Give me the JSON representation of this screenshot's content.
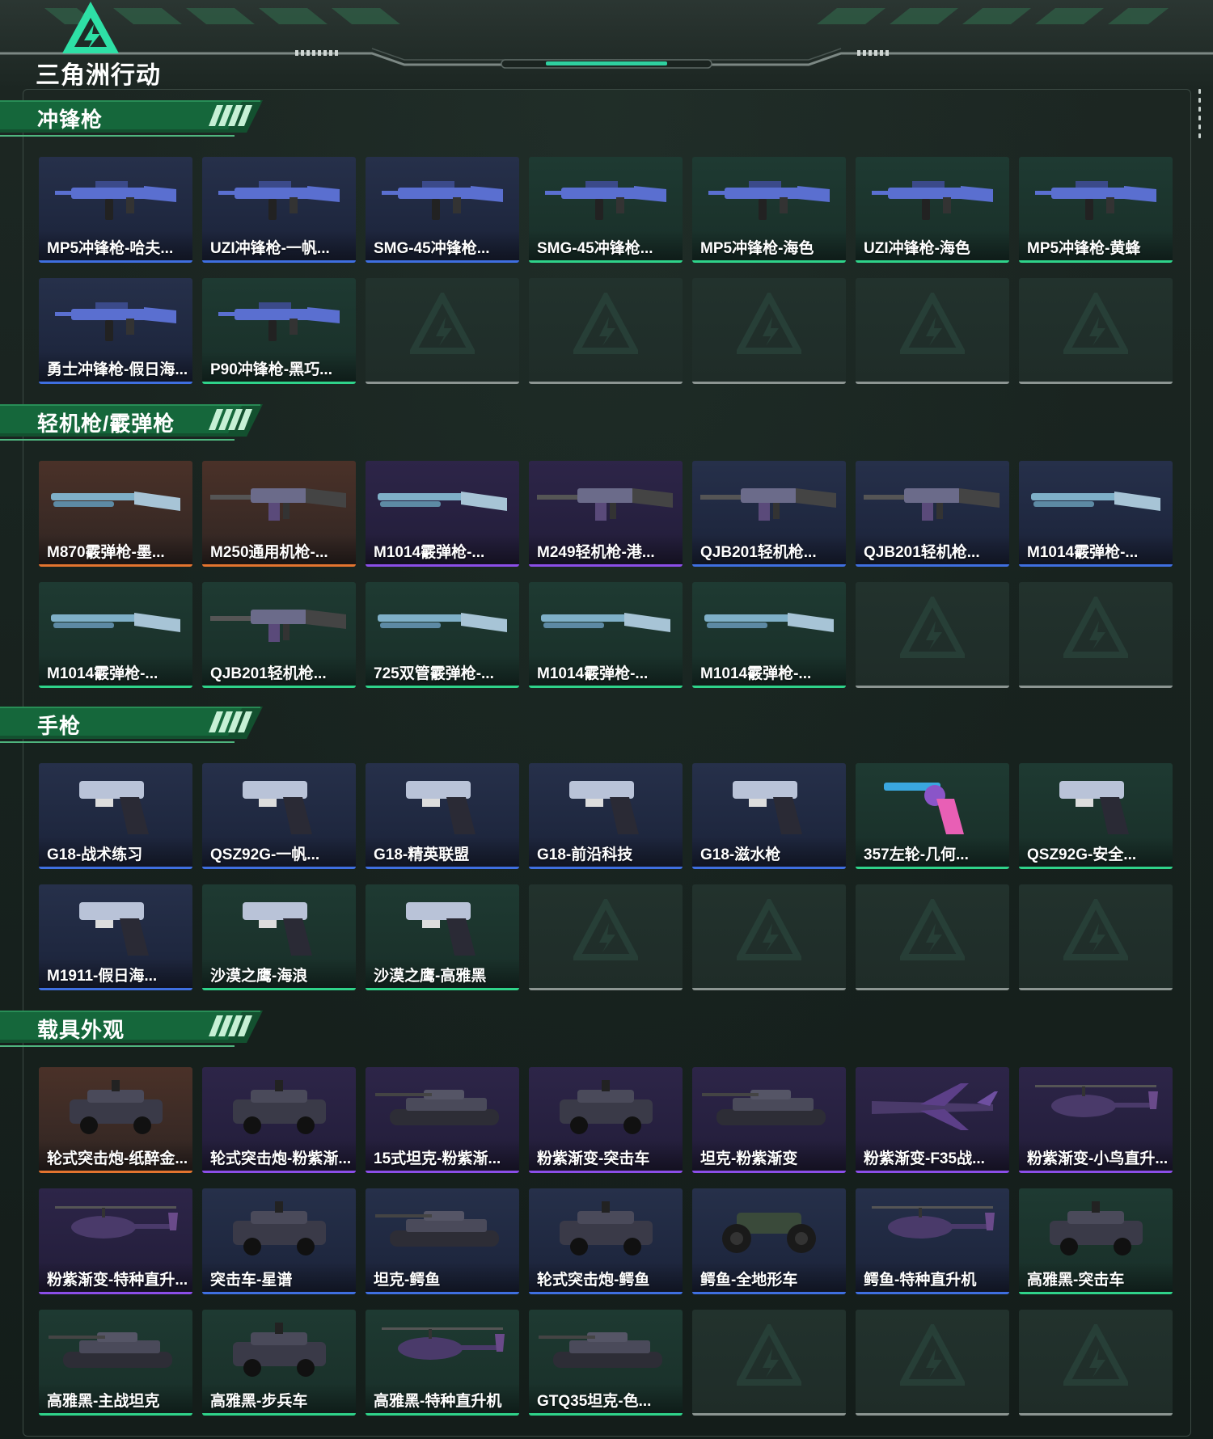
{
  "header": {
    "logo_text": "三角洲行动"
  },
  "colors": {
    "blue": "#3f6fe0",
    "green": "#2fd38a",
    "orange": "#e3742f",
    "purple": "#8b4ee8",
    "empty": "#8c9592",
    "accent": "#28d49a"
  },
  "sections": [
    {
      "title": "冲锋枪",
      "rows": [
        [
          {
            "name": "MP5冲锋枪-哈夫...",
            "rarity": "blue",
            "icon": "smg"
          },
          {
            "name": "UZI冲锋枪-一帆...",
            "rarity": "blue",
            "icon": "smg"
          },
          {
            "name": "SMG-45冲锋枪...",
            "rarity": "blue",
            "icon": "smg"
          },
          {
            "name": "SMG-45冲锋枪...",
            "rarity": "green",
            "icon": "smg"
          },
          {
            "name": "MP5冲锋枪-海色",
            "rarity": "green",
            "icon": "smg"
          },
          {
            "name": "UZI冲锋枪-海色",
            "rarity": "green",
            "icon": "smg"
          },
          {
            "name": "MP5冲锋枪-黄蜂",
            "rarity": "green",
            "icon": "smg"
          }
        ],
        [
          {
            "name": "勇士冲锋枪-假日海...",
            "rarity": "blue",
            "icon": "smg"
          },
          {
            "name": "P90冲锋枪-黑巧...",
            "rarity": "green",
            "icon": "smg"
          },
          null,
          null,
          null,
          null,
          null
        ]
      ]
    },
    {
      "title": "轻机枪/霰弹枪",
      "rows": [
        [
          {
            "name": "M870霰弹枪-墨...",
            "rarity": "orange",
            "icon": "shotgun"
          },
          {
            "name": "M250通用机枪-...",
            "rarity": "orange",
            "icon": "lmg"
          },
          {
            "name": "M1014霰弹枪-...",
            "rarity": "purple",
            "icon": "shotgun"
          },
          {
            "name": "M249轻机枪-港...",
            "rarity": "purple",
            "icon": "lmg"
          },
          {
            "name": "QJB201轻机枪...",
            "rarity": "blue",
            "icon": "lmg"
          },
          {
            "name": "QJB201轻机枪...",
            "rarity": "blue",
            "icon": "lmg"
          },
          {
            "name": "M1014霰弹枪-...",
            "rarity": "blue",
            "icon": "shotgun"
          }
        ],
        [
          {
            "name": "M1014霰弹枪-...",
            "rarity": "green",
            "icon": "shotgun"
          },
          {
            "name": "QJB201轻机枪...",
            "rarity": "green",
            "icon": "lmg"
          },
          {
            "name": "725双管霰弹枪-...",
            "rarity": "green",
            "icon": "shotgun"
          },
          {
            "name": "M1014霰弹枪-...",
            "rarity": "green",
            "icon": "shotgun"
          },
          {
            "name": "M1014霰弹枪-...",
            "rarity": "green",
            "icon": "shotgun"
          },
          null,
          null
        ]
      ]
    },
    {
      "title": "手枪",
      "rows": [
        [
          {
            "name": "G18-战术练习",
            "rarity": "blue",
            "icon": "pistol"
          },
          {
            "name": "QSZ92G-一帆...",
            "rarity": "blue",
            "icon": "pistol"
          },
          {
            "name": "G18-精英联盟",
            "rarity": "blue",
            "icon": "pistol"
          },
          {
            "name": "G18-前沿科技",
            "rarity": "blue",
            "icon": "pistol"
          },
          {
            "name": "G18-滋水枪",
            "rarity": "blue",
            "icon": "pistol"
          },
          {
            "name": "357左轮-几何...",
            "rarity": "green",
            "icon": "revolver"
          },
          {
            "name": "QSZ92G-安全...",
            "rarity": "green",
            "icon": "pistol"
          }
        ],
        [
          {
            "name": "M1911-假日海...",
            "rarity": "blue",
            "icon": "pistol"
          },
          {
            "name": "沙漠之鹰-海浪",
            "rarity": "green",
            "icon": "pistol"
          },
          {
            "name": "沙漠之鹰-高雅黑",
            "rarity": "green",
            "icon": "pistol"
          },
          null,
          null,
          null,
          null
        ]
      ]
    },
    {
      "title": "载具外观",
      "rows": [
        [
          {
            "name": "轮式突击炮-纸醉金...",
            "rarity": "orange",
            "icon": "vehicle"
          },
          {
            "name": "轮式突击炮-粉紫渐...",
            "rarity": "purple",
            "icon": "vehicle"
          },
          {
            "name": "15式坦克-粉紫渐...",
            "rarity": "purple",
            "icon": "tank"
          },
          {
            "name": "粉紫渐变-突击车",
            "rarity": "purple",
            "icon": "vehicle"
          },
          {
            "name": "坦克-粉紫渐变",
            "rarity": "purple",
            "icon": "tank"
          },
          {
            "name": "粉紫渐变-F35战...",
            "rarity": "purple",
            "icon": "jet"
          },
          {
            "name": "粉紫渐变-小鸟直升...",
            "rarity": "purple",
            "icon": "heli"
          }
        ],
        [
          {
            "name": "粉紫渐变-特种直升...",
            "rarity": "purple",
            "icon": "heli"
          },
          {
            "name": "突击车-星谱",
            "rarity": "blue",
            "icon": "vehicle"
          },
          {
            "name": "坦克-鳄鱼",
            "rarity": "blue",
            "icon": "tank"
          },
          {
            "name": "轮式突击炮-鳄鱼",
            "rarity": "blue",
            "icon": "vehicle"
          },
          {
            "name": "鳄鱼-全地形车",
            "rarity": "blue",
            "icon": "atv"
          },
          {
            "name": "鳄鱼-特种直升机",
            "rarity": "blue",
            "icon": "heli"
          },
          {
            "name": "高雅黑-突击车",
            "rarity": "green",
            "icon": "vehicle"
          }
        ],
        [
          {
            "name": "高雅黑-主战坦克",
            "rarity": "green",
            "icon": "tank"
          },
          {
            "name": "高雅黑-步兵车",
            "rarity": "green",
            "icon": "vehicle"
          },
          {
            "name": "高雅黑-特种直升机",
            "rarity": "green",
            "icon": "heli"
          },
          {
            "name": "GTQ35坦克-色...",
            "rarity": "green",
            "icon": "tank"
          },
          null,
          null,
          null
        ]
      ]
    }
  ]
}
